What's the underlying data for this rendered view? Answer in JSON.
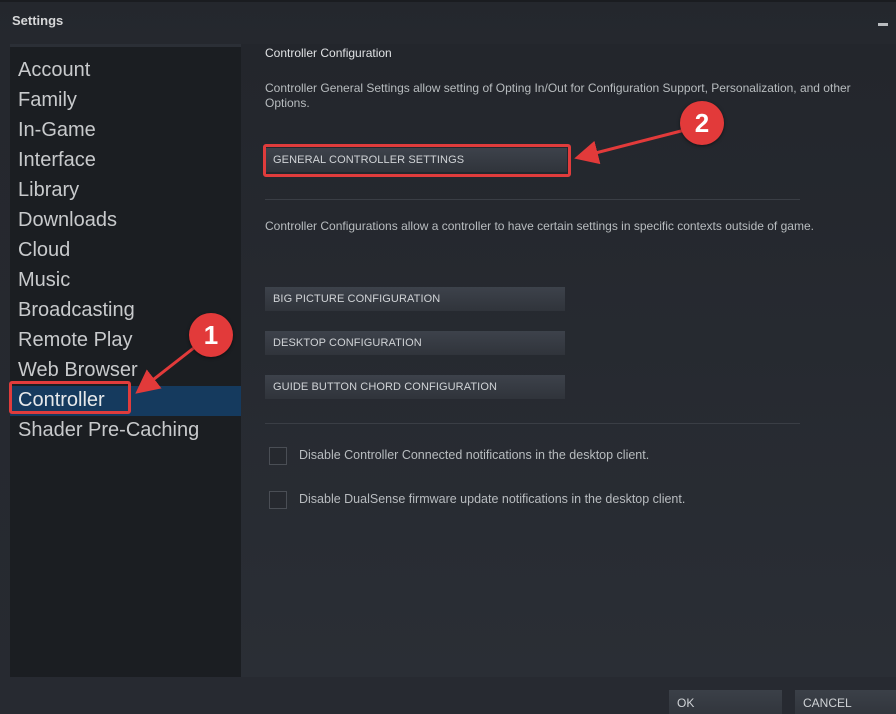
{
  "window": {
    "title": "Settings"
  },
  "sidebar": {
    "items": [
      {
        "label": "Account"
      },
      {
        "label": "Family"
      },
      {
        "label": "In-Game"
      },
      {
        "label": "Interface"
      },
      {
        "label": "Library"
      },
      {
        "label": "Downloads"
      },
      {
        "label": "Cloud"
      },
      {
        "label": "Music"
      },
      {
        "label": "Broadcasting"
      },
      {
        "label": "Remote Play"
      },
      {
        "label": "Web Browser"
      },
      {
        "label": "Controller",
        "active": true
      },
      {
        "label": "Shader Pre-Caching"
      }
    ]
  },
  "content": {
    "section_title": "Controller Configuration",
    "general_desc": "Controller General Settings allow setting of Opting In/Out for Configuration Support, Personalization, and other Options.",
    "general_button": "GENERAL CONTROLLER SETTINGS",
    "config_desc": "Controller Configurations allow a controller to have certain settings in specific contexts outside of game.",
    "config_buttons": [
      "BIG PICTURE CONFIGURATION",
      "DESKTOP CONFIGURATION",
      "GUIDE BUTTON CHORD CONFIGURATION"
    ],
    "checkboxes": [
      {
        "label": "Disable Controller Connected notifications in the desktop client.",
        "checked": false
      },
      {
        "label": "Disable DualSense firmware update notifications in the desktop client.",
        "checked": false
      }
    ]
  },
  "footer": {
    "ok": "OK",
    "cancel": "CANCEL"
  },
  "annotations": {
    "badge_1": "1",
    "badge_2": "2",
    "color": "#e23a3a"
  }
}
